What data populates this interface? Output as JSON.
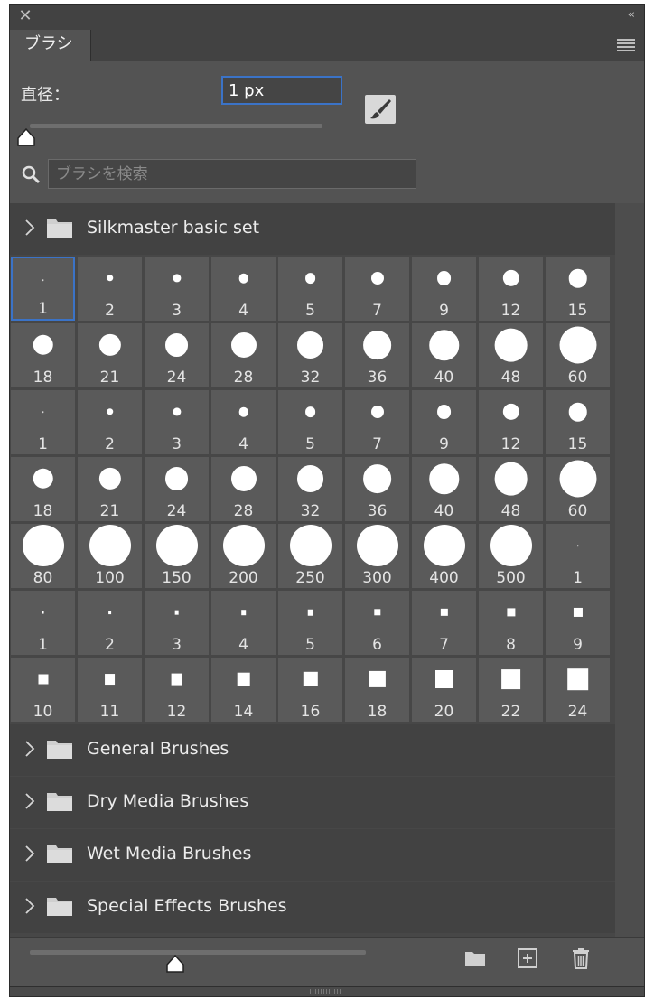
{
  "panel": {
    "tab_label": "ブラシ",
    "close_glyph": "✕",
    "collapse_glyph": "‹‹",
    "menu_icon": "hamburger-menu-icon"
  },
  "size": {
    "label": "直径：",
    "value": "1 px",
    "slider_fraction": 0.0
  },
  "search": {
    "placeholder": "ブラシを検索",
    "icon": "search-icon"
  },
  "groups": [
    {
      "name": "Silkmaster basic set",
      "expanded": true
    },
    {
      "name": "General Brushes",
      "expanded": false
    },
    {
      "name": "Dry Media Brushes",
      "expanded": false
    },
    {
      "name": "Wet Media Brushes",
      "expanded": false
    },
    {
      "name": "Special Effects Brushes",
      "expanded": false
    }
  ],
  "brush_grid": {
    "selected_index": 0,
    "rows": [
      [
        {
          "label": "1",
          "shape": "round"
        },
        {
          "label": "2",
          "shape": "round"
        },
        {
          "label": "3",
          "shape": "round"
        },
        {
          "label": "4",
          "shape": "round"
        },
        {
          "label": "5",
          "shape": "round"
        },
        {
          "label": "7",
          "shape": "round"
        },
        {
          "label": "9",
          "shape": "round"
        },
        {
          "label": "12",
          "shape": "round"
        },
        {
          "label": "15",
          "shape": "round"
        }
      ],
      [
        {
          "label": "18",
          "shape": "round"
        },
        {
          "label": "21",
          "shape": "round"
        },
        {
          "label": "24",
          "shape": "round"
        },
        {
          "label": "28",
          "shape": "round"
        },
        {
          "label": "32",
          "shape": "round"
        },
        {
          "label": "36",
          "shape": "round"
        },
        {
          "label": "40",
          "shape": "round"
        },
        {
          "label": "48",
          "shape": "round"
        },
        {
          "label": "60",
          "shape": "round"
        }
      ],
      [
        {
          "label": "1",
          "shape": "round"
        },
        {
          "label": "2",
          "shape": "round"
        },
        {
          "label": "3",
          "shape": "round"
        },
        {
          "label": "4",
          "shape": "round"
        },
        {
          "label": "5",
          "shape": "round"
        },
        {
          "label": "7",
          "shape": "round"
        },
        {
          "label": "9",
          "shape": "round"
        },
        {
          "label": "12",
          "shape": "round"
        },
        {
          "label": "15",
          "shape": "round"
        }
      ],
      [
        {
          "label": "18",
          "shape": "round"
        },
        {
          "label": "21",
          "shape": "round"
        },
        {
          "label": "24",
          "shape": "round"
        },
        {
          "label": "28",
          "shape": "round"
        },
        {
          "label": "32",
          "shape": "round"
        },
        {
          "label": "36",
          "shape": "round"
        },
        {
          "label": "40",
          "shape": "round"
        },
        {
          "label": "48",
          "shape": "round"
        },
        {
          "label": "60",
          "shape": "round"
        }
      ],
      [
        {
          "label": "80",
          "shape": "round"
        },
        {
          "label": "100",
          "shape": "round"
        },
        {
          "label": "150",
          "shape": "round"
        },
        {
          "label": "200",
          "shape": "round"
        },
        {
          "label": "250",
          "shape": "round"
        },
        {
          "label": "300",
          "shape": "round"
        },
        {
          "label": "400",
          "shape": "round"
        },
        {
          "label": "500",
          "shape": "round"
        },
        {
          "label": "1",
          "shape": "round"
        }
      ],
      [
        {
          "label": "1",
          "shape": "square"
        },
        {
          "label": "2",
          "shape": "square"
        },
        {
          "label": "3",
          "shape": "square"
        },
        {
          "label": "4",
          "shape": "square"
        },
        {
          "label": "5",
          "shape": "square"
        },
        {
          "label": "6",
          "shape": "square"
        },
        {
          "label": "7",
          "shape": "square"
        },
        {
          "label": "8",
          "shape": "square"
        },
        {
          "label": "9",
          "shape": "square"
        }
      ],
      [
        {
          "label": "10",
          "shape": "square"
        },
        {
          "label": "11",
          "shape": "square"
        },
        {
          "label": "12",
          "shape": "square"
        },
        {
          "label": "14",
          "shape": "square"
        },
        {
          "label": "16",
          "shape": "square"
        },
        {
          "label": "18",
          "shape": "square"
        },
        {
          "label": "20",
          "shape": "square"
        },
        {
          "label": "22",
          "shape": "square"
        },
        {
          "label": "24",
          "shape": "square"
        }
      ]
    ]
  },
  "bottom": {
    "preview_slider_fraction": 0.44,
    "icons": [
      "folder-icon",
      "add-brush-icon",
      "trash-icon"
    ]
  },
  "colors": {
    "panel_bg": "#535353",
    "header_bg": "#424242",
    "accent": "#3b73c7",
    "cell_bg": "#5a5a5a"
  }
}
